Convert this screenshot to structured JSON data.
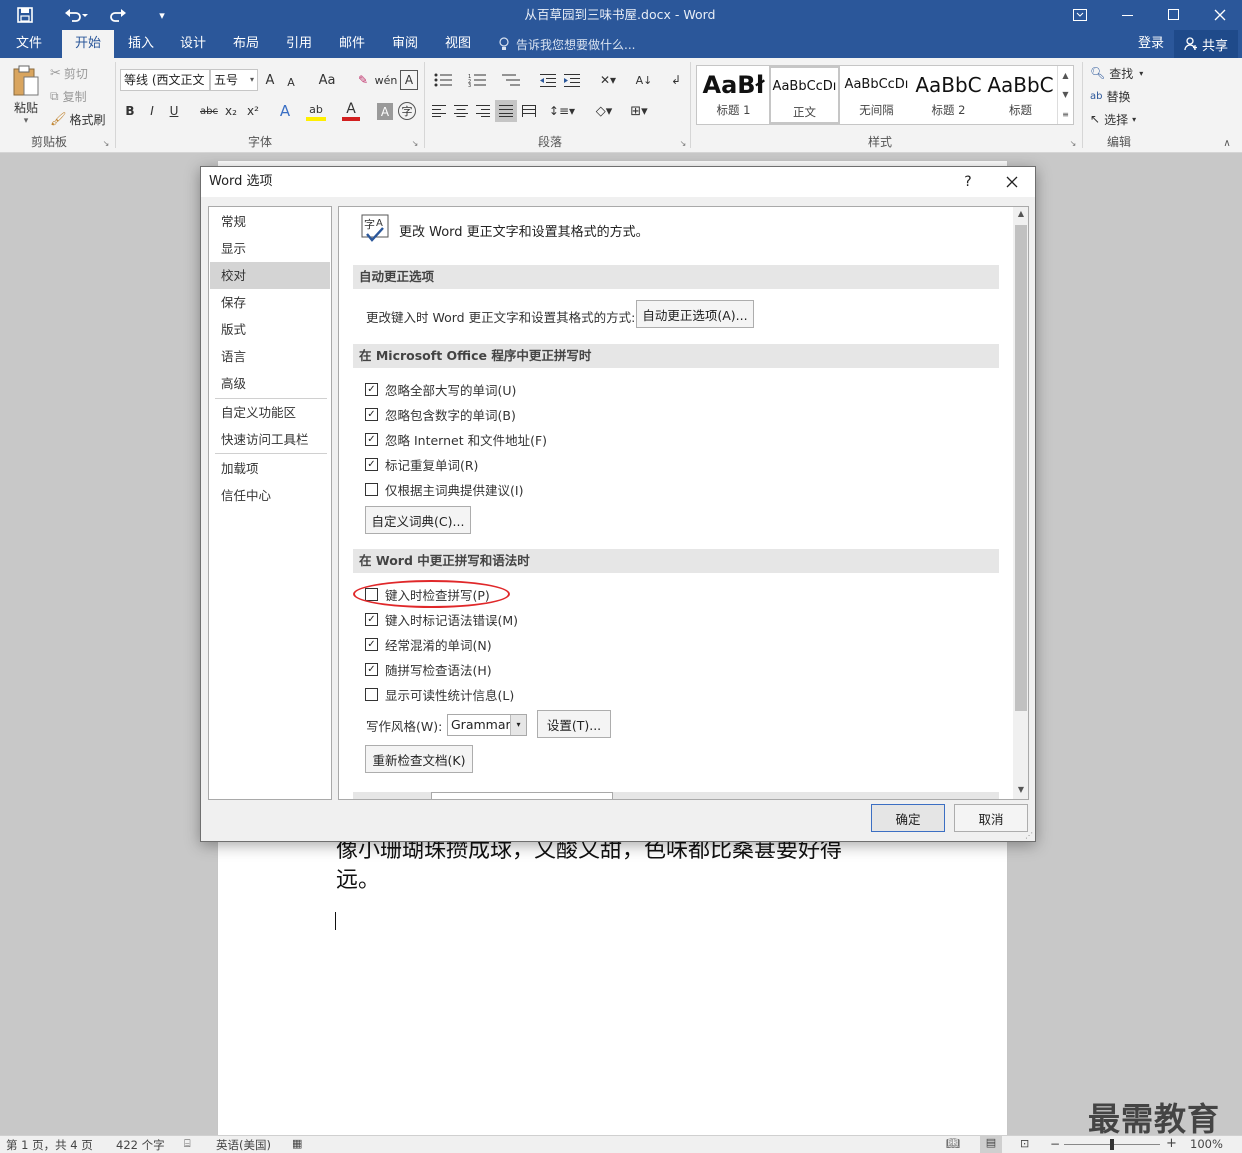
{
  "window": {
    "title": "从百草园到三味书屋.docx - Word"
  },
  "qat": {
    "save_icon": "save-icon",
    "undo_icon": "undo-icon",
    "redo_icon": "redo-icon",
    "customize": "▾"
  },
  "tabs": {
    "file": "文件",
    "home": "开始",
    "insert": "插入",
    "design": "设计",
    "layout": "布局",
    "references": "引用",
    "mailings": "邮件",
    "review": "审阅",
    "view": "视图",
    "tellme": "告诉我您想要做什么..."
  },
  "account": {
    "login": "登录",
    "share": "共享"
  },
  "ribbon": {
    "clipboard": {
      "paste": "粘贴",
      "cut": "剪切",
      "copy": "复制",
      "format_painter": "格式刷",
      "group": "剪贴板"
    },
    "font": {
      "font_name": "等线 (西文正文",
      "font_size": "五号",
      "group": "字体",
      "bold": "B",
      "italic": "I",
      "underline": "U",
      "strike": "abc",
      "sub": "x₂",
      "sup": "x²",
      "grow": "A",
      "shrink": "A",
      "case": "Aa"
    },
    "paragraph": {
      "group": "段落"
    },
    "styles": {
      "group": "样式",
      "items": [
        {
          "preview": "AaBł",
          "name": "标题 1"
        },
        {
          "preview": "AaBbCcDı",
          "name": "正文"
        },
        {
          "preview": "AaBbCcDı",
          "name": "无间隔"
        },
        {
          "preview": "AaBbC",
          "name": "标题 2"
        },
        {
          "preview": "AaBbC",
          "name": "标题"
        }
      ]
    },
    "editing": {
      "find": "查找",
      "replace": "替换",
      "select": "选择",
      "group": "编辑"
    }
  },
  "document": {
    "line1": "像小珊瑚珠攒成球，又酸又甜，色味都比桑葚要好得",
    "line2": "远。"
  },
  "status": {
    "page": "第 1 页，共 4 页",
    "words": "422 个字",
    "lang": "英语(美国)",
    "zoom": "100%"
  },
  "watermark": "最需教育",
  "dialog": {
    "title": "Word 选项",
    "help": "?",
    "nav": [
      "常规",
      "显示",
      "校对",
      "保存",
      "版式",
      "语言",
      "高级",
      "自定义功能区",
      "快速访问工具栏",
      "加载项",
      "信任中心"
    ],
    "header": "更改 Word 更正文字和设置其格式的方式。",
    "autocorrect": {
      "title": "自动更正选项",
      "desc": "更改键入时 Word 更正文字和设置其格式的方式:",
      "button": "自动更正选项(A)..."
    },
    "office": {
      "title": "在 Microsoft Office 程序中更正拼写时",
      "options": [
        {
          "label": "忽略全部大写的单词(U)",
          "checked": true
        },
        {
          "label": "忽略包含数字的单词(B)",
          "checked": true
        },
        {
          "label": "忽略 Internet 和文件地址(F)",
          "checked": true
        },
        {
          "label": "标记重复单词(R)",
          "checked": true
        },
        {
          "label": "仅根据主词典提供建议(I)",
          "checked": false
        }
      ],
      "dict_button": "自定义词典(C)..."
    },
    "word": {
      "title": "在 Word 中更正拼写和语法时",
      "options": [
        {
          "label": "键入时检查拼写(P)",
          "checked": false
        },
        {
          "label": "键入时标记语法错误(M)",
          "checked": true
        },
        {
          "label": "经常混淆的单词(N)",
          "checked": true
        },
        {
          "label": "随拼写检查语法(H)",
          "checked": true
        },
        {
          "label": "显示可读性统计信息(L)",
          "checked": false
        }
      ],
      "style_label": "写作风格(W):",
      "style_value": "Grammar",
      "settings_button": "设置(T)...",
      "recheck_button": "重新检查文档(K)"
    },
    "highlight_color": "#e0282a",
    "ok": "确定",
    "cancel": "取消"
  },
  "colors": {
    "brand": "#2b579a"
  }
}
